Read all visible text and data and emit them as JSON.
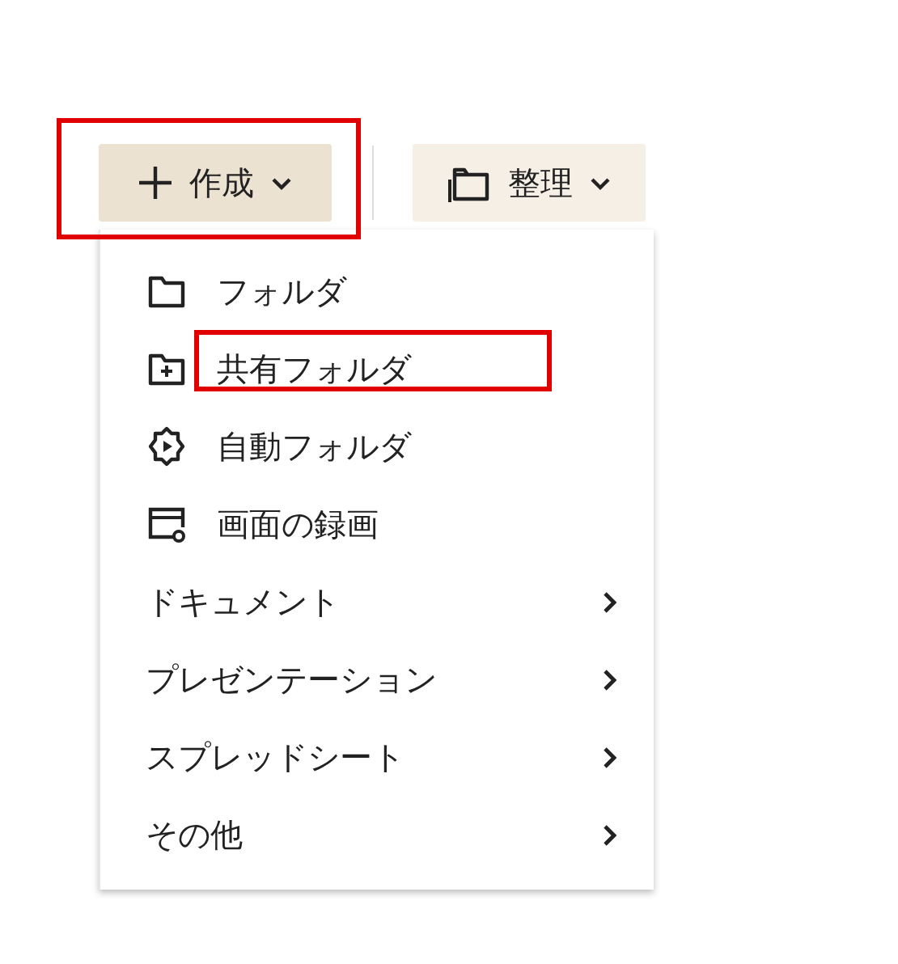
{
  "toolbar": [
    {
      "kind": "create",
      "label": "作成",
      "highlighted": true
    },
    {
      "kind": "organize",
      "label": "整理",
      "highlighted": false
    }
  ],
  "menu": {
    "items": [
      {
        "kind": "folder",
        "label": "フォルダ",
        "highlighted": false
      },
      {
        "kind": "shared",
        "label": "共有フォルダ",
        "highlighted": true
      },
      {
        "kind": "automatic",
        "label": "自動フォルダ",
        "highlighted": false
      },
      {
        "kind": "recording",
        "label": "画面の録画",
        "highlighted": false
      },
      {
        "kind": "submenu",
        "label": "ドキュメント",
        "highlighted": false
      },
      {
        "kind": "submenu",
        "label": "プレゼンテーション",
        "highlighted": false
      },
      {
        "kind": "submenu",
        "label": "スプレッドシート",
        "highlighted": false
      },
      {
        "kind": "submenu",
        "label": "その他",
        "highlighted": false
      }
    ]
  }
}
